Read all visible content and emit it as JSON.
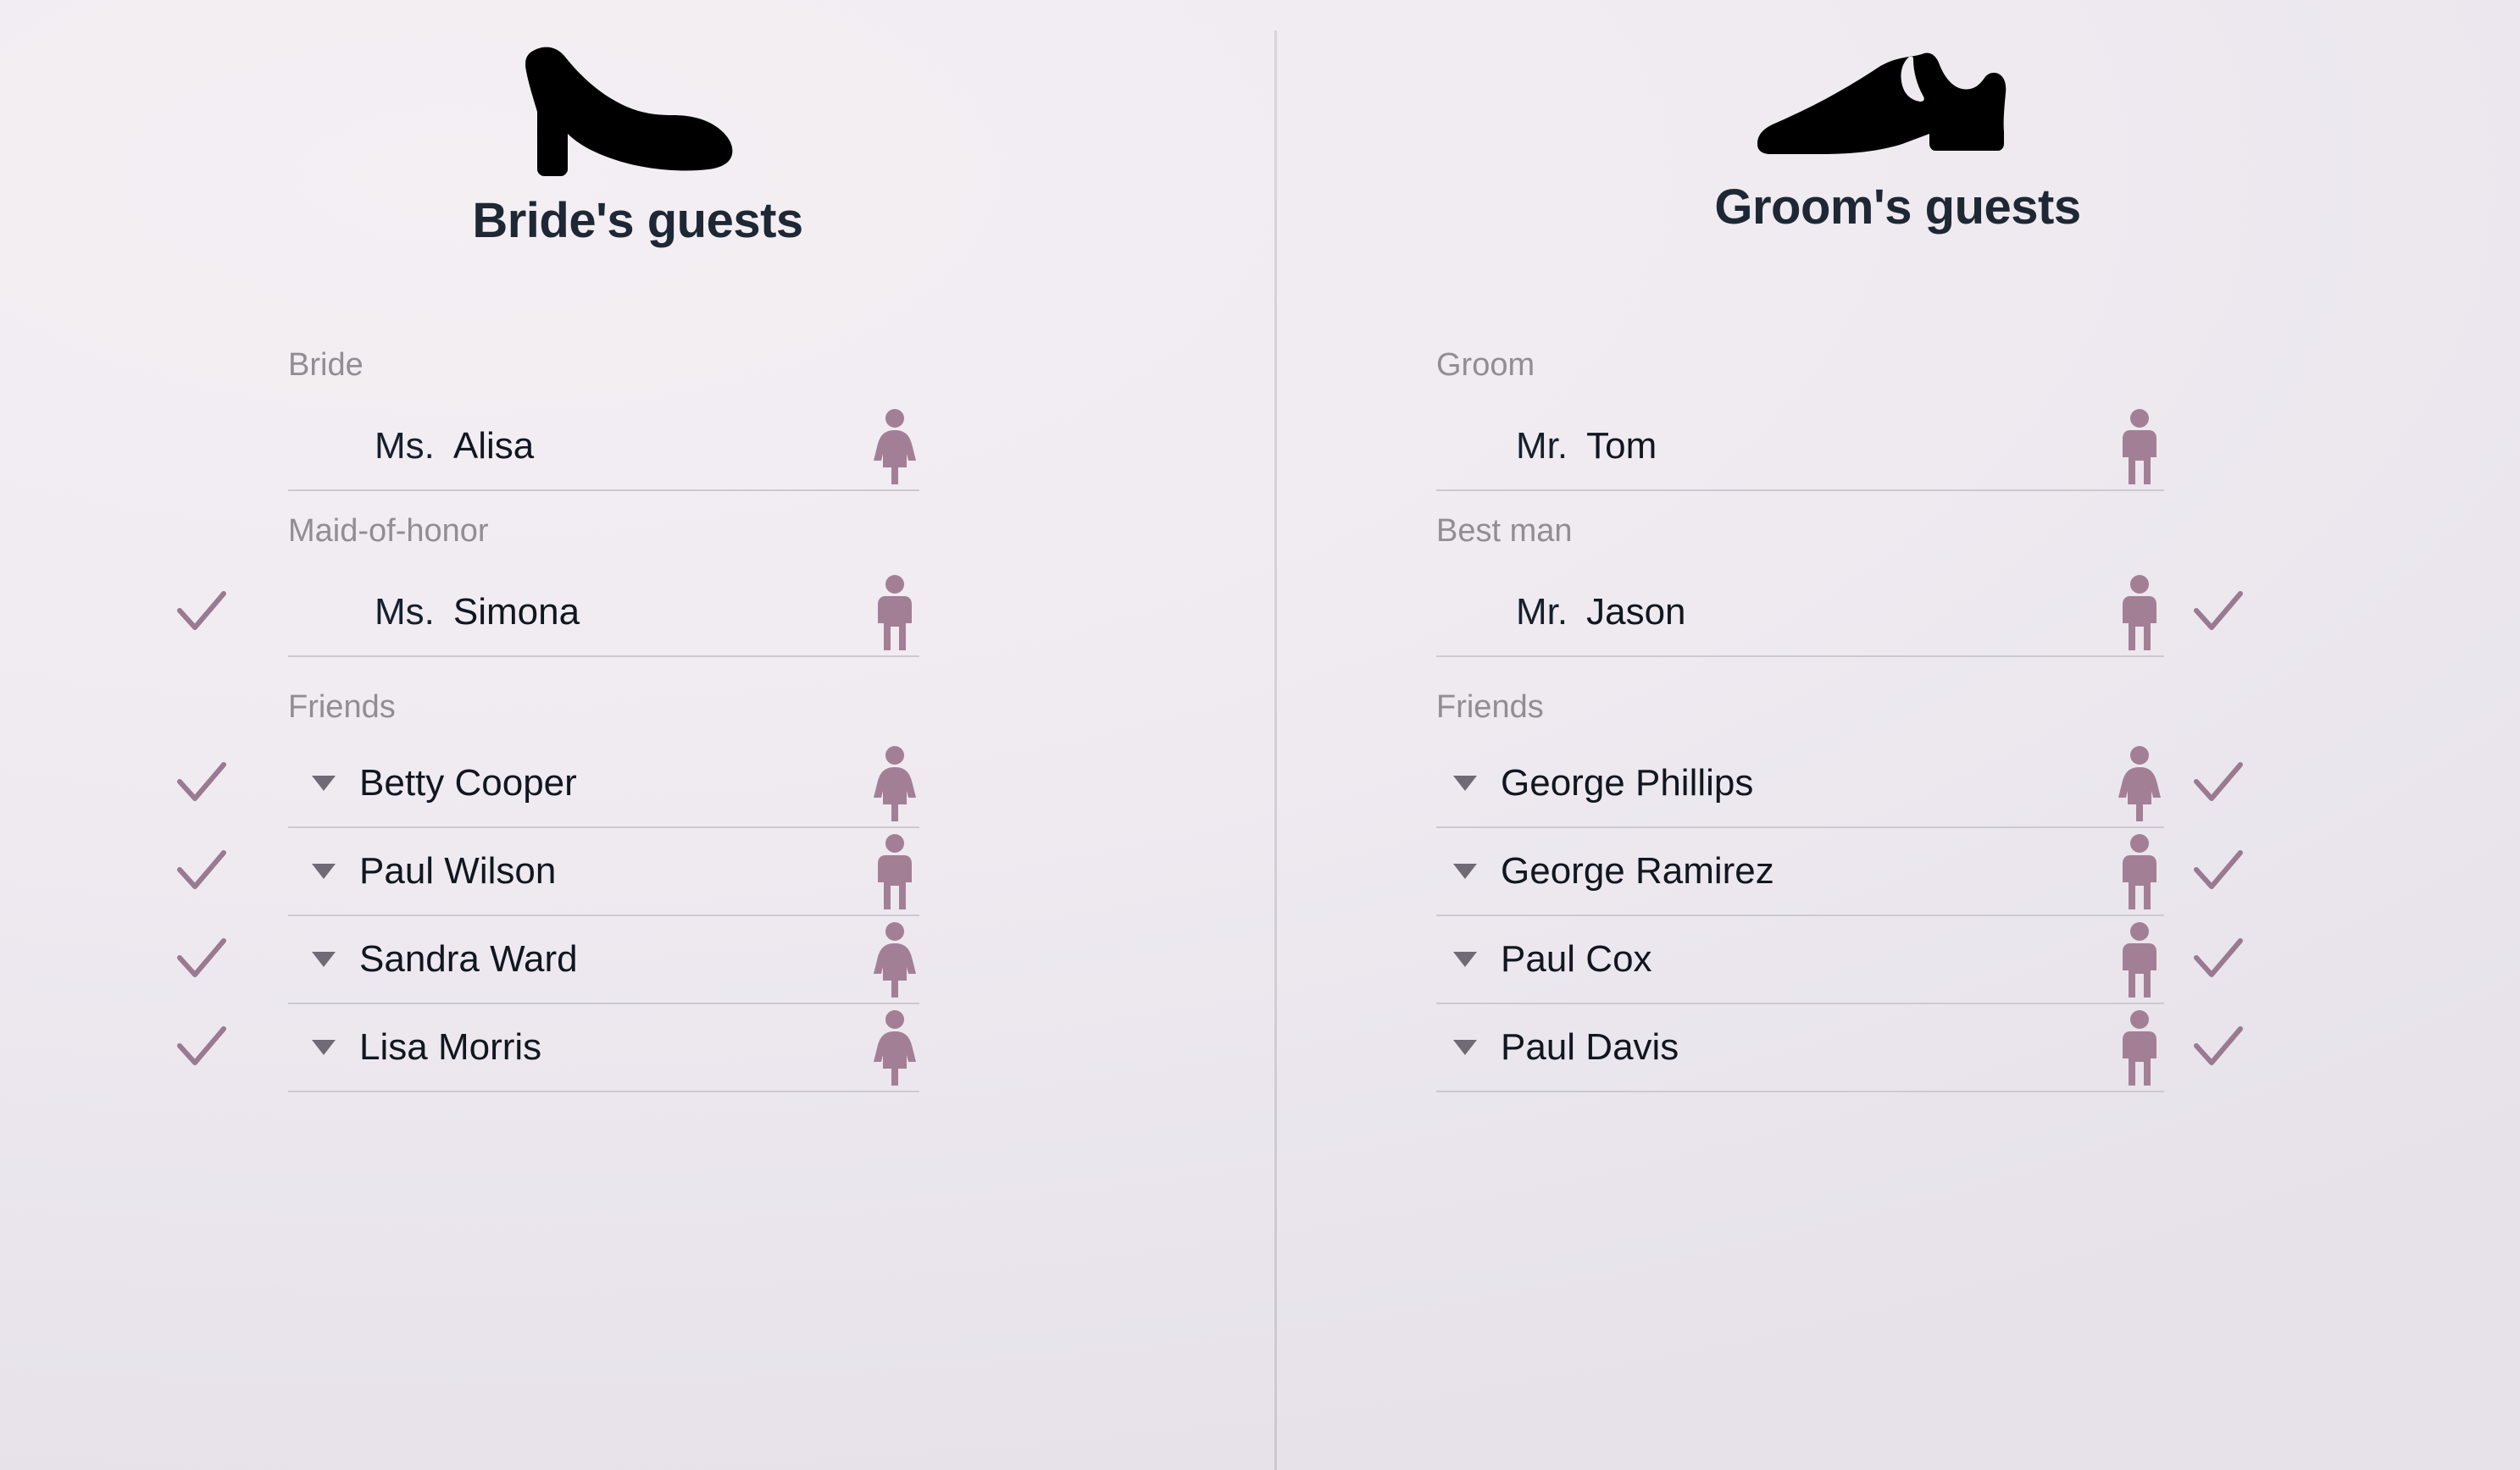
{
  "columns": [
    {
      "side": "left",
      "shoe_icon": "high-heel-shoe-icon",
      "title": "Bride's guests",
      "groups": [
        {
          "label": "Bride",
          "rows": [
            {
              "checked": false,
              "caret": false,
              "honorific": "Ms.",
              "name": "Alisa",
              "figure": "female"
            }
          ]
        },
        {
          "label": "Maid-of-honor",
          "rows": [
            {
              "checked": true,
              "caret": false,
              "honorific": "Ms.",
              "name": "Simona",
              "figure": "male"
            }
          ]
        },
        {
          "label": "Friends",
          "rows": [
            {
              "checked": true,
              "caret": true,
              "honorific": "",
              "name": "Betty Cooper",
              "figure": "female"
            },
            {
              "checked": true,
              "caret": true,
              "honorific": "",
              "name": "Paul Wilson",
              "figure": "male"
            },
            {
              "checked": true,
              "caret": true,
              "honorific": "",
              "name": "Sandra Ward",
              "figure": "female"
            },
            {
              "checked": true,
              "caret": true,
              "honorific": "",
              "name": "Lisa Morris",
              "figure": "female"
            }
          ]
        }
      ]
    },
    {
      "side": "right",
      "shoe_icon": "dress-shoe-icon",
      "title": "Groom's guests",
      "groups": [
        {
          "label": "Groom",
          "rows": [
            {
              "checked": false,
              "caret": false,
              "honorific": "Mr.",
              "name": "Tom",
              "figure": "male"
            }
          ]
        },
        {
          "label": "Best man",
          "rows": [
            {
              "checked": true,
              "caret": false,
              "honorific": "Mr.",
              "name": "Jason",
              "figure": "male"
            }
          ]
        },
        {
          "label": "Friends",
          "rows": [
            {
              "checked": true,
              "caret": true,
              "honorific": "",
              "name": "George Phillips",
              "figure": "female"
            },
            {
              "checked": true,
              "caret": true,
              "honorific": "",
              "name": "George Ramirez",
              "figure": "male"
            },
            {
              "checked": true,
              "caret": true,
              "honorific": "",
              "name": "Paul Cox",
              "figure": "male"
            },
            {
              "checked": true,
              "caret": true,
              "honorific": "",
              "name": "Paul Davis",
              "figure": "male"
            }
          ]
        }
      ]
    }
  ],
  "colors": {
    "background": "#efebf1",
    "figure": "#a37f96",
    "check": "#9a7a90",
    "title": "#1e2834",
    "group_label": "#918d94",
    "rule": "#cdc9d2",
    "divider": "#d2ced8",
    "shoe": "#000000",
    "caret": "#6f6a74"
  }
}
